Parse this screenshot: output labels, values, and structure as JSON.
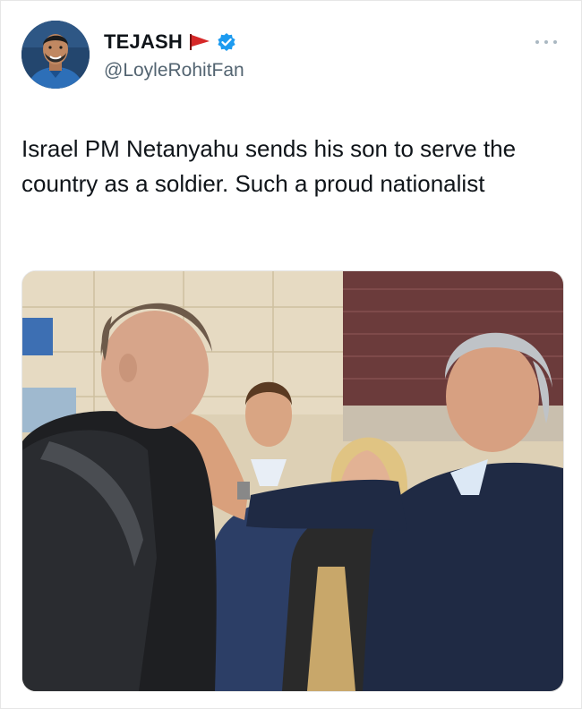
{
  "tweet": {
    "author": {
      "display_name": "TEJASH",
      "handle": "@LoyleRohitFan",
      "avatar_icon": "profile-photo",
      "flag_icon": "red-flag-icon",
      "verified": true,
      "verified_color": "#1d9bf0"
    },
    "text": "Israel PM Netanyahu sends his son to serve the country as a soldier. Such a proud nationalist",
    "media": {
      "type": "photo"
    },
    "more_icon": "more-dots-icon"
  },
  "colors": {
    "text_primary": "#0f1419",
    "text_secondary": "#536471",
    "flag_red": "#d62828",
    "verified_blue": "#1d9bf0"
  }
}
